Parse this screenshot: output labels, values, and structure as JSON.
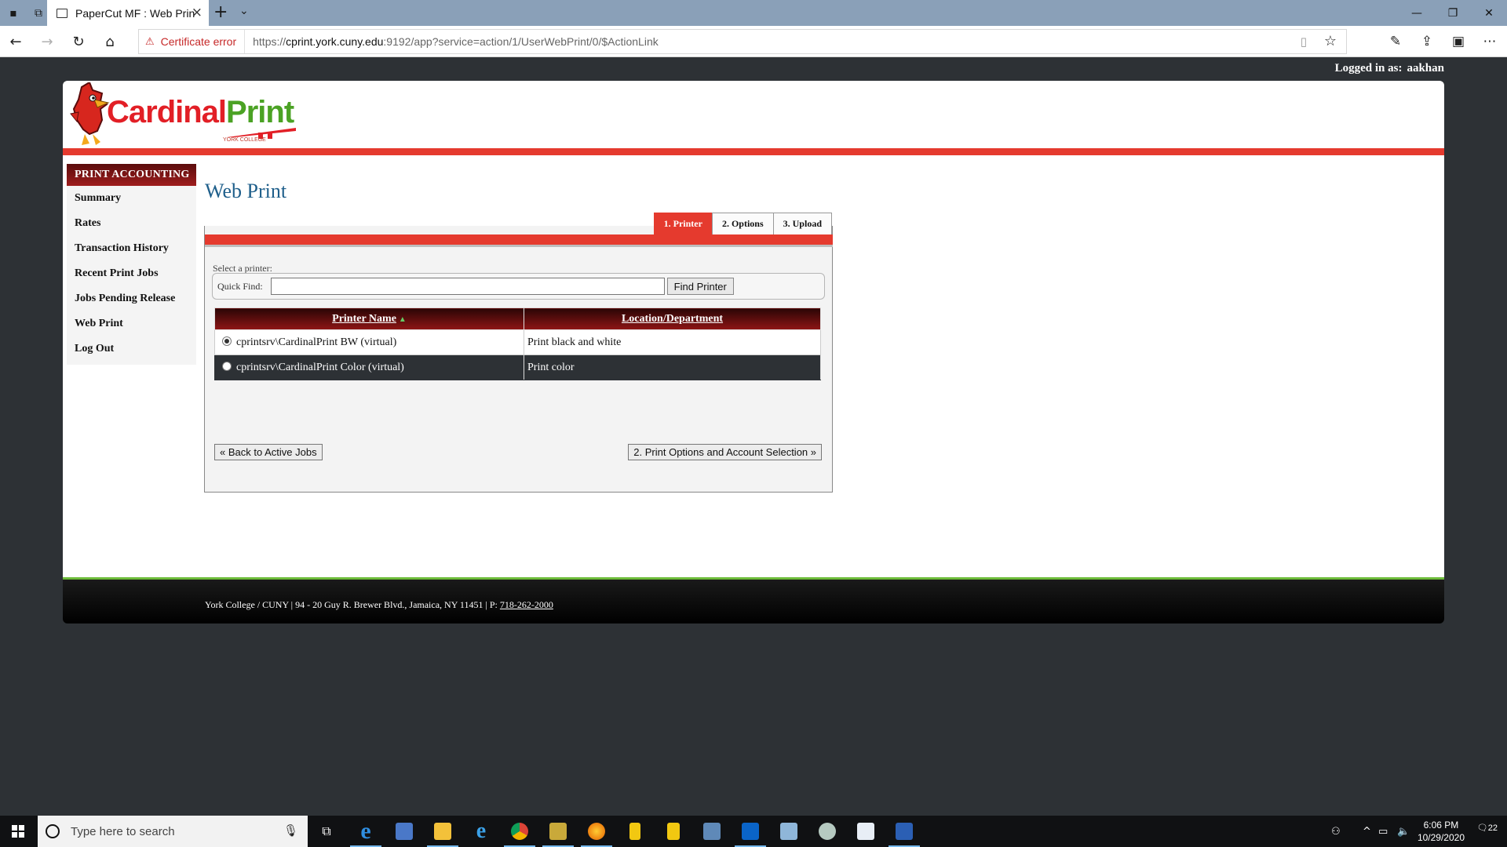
{
  "browser": {
    "tab_title": "PaperCut MF : Web Prin",
    "cert_error": "Certificate error",
    "url_prefix": "https://",
    "url_host": "cprint.york.cuny.edu",
    "url_rest": ":9192/app?service=action/1/UserWebPrint/0/$ActionLink"
  },
  "header": {
    "logged_in_label": "Logged in as:",
    "username": "aakhan",
    "logo_part1": "Cardinal",
    "logo_part2": "Print",
    "logo_sub": "YORK COLLEGE"
  },
  "sidebar": {
    "title": "PRINT ACCOUNTING",
    "items": [
      {
        "label": "Summary"
      },
      {
        "label": "Rates"
      },
      {
        "label": "Transaction History"
      },
      {
        "label": "Recent Print Jobs"
      },
      {
        "label": "Jobs Pending Release"
      },
      {
        "label": "Web Print"
      },
      {
        "label": "Log Out"
      }
    ]
  },
  "main": {
    "title": "Web Print",
    "steps": [
      "1. Printer",
      "2. Options",
      "3. Upload"
    ],
    "select_label": "Select a printer:",
    "quick_find_label": "Quick Find:",
    "quick_find_value": "",
    "find_button": "Find Printer",
    "table": {
      "headers": [
        "Printer Name",
        "Location/Department"
      ],
      "rows": [
        {
          "name": "cprintsrv\\CardinalPrint BW (virtual)",
          "location": "Print black and white",
          "selected": true
        },
        {
          "name": "cprintsrv\\CardinalPrint Color (virtual)",
          "location": "Print color",
          "selected": false
        }
      ]
    },
    "back_button": "« Back to Active Jobs",
    "next_button": "2. Print Options and Account Selection »"
  },
  "footer": {
    "text": "York College / CUNY | 94 - 20 Guy R. Brewer Blvd., Jamaica, NY 11451 | P: ",
    "phone": "718-262-2000"
  },
  "taskbar": {
    "search_placeholder": "Type here to search",
    "time": "6:06 PM",
    "date": "10/29/2020",
    "notifications": "22"
  },
  "colors": {
    "accent_red": "#e53a2e",
    "brand_green": "#4ba224",
    "title_blue": "#1f5f8b",
    "dark_bg": "#2d3135"
  }
}
